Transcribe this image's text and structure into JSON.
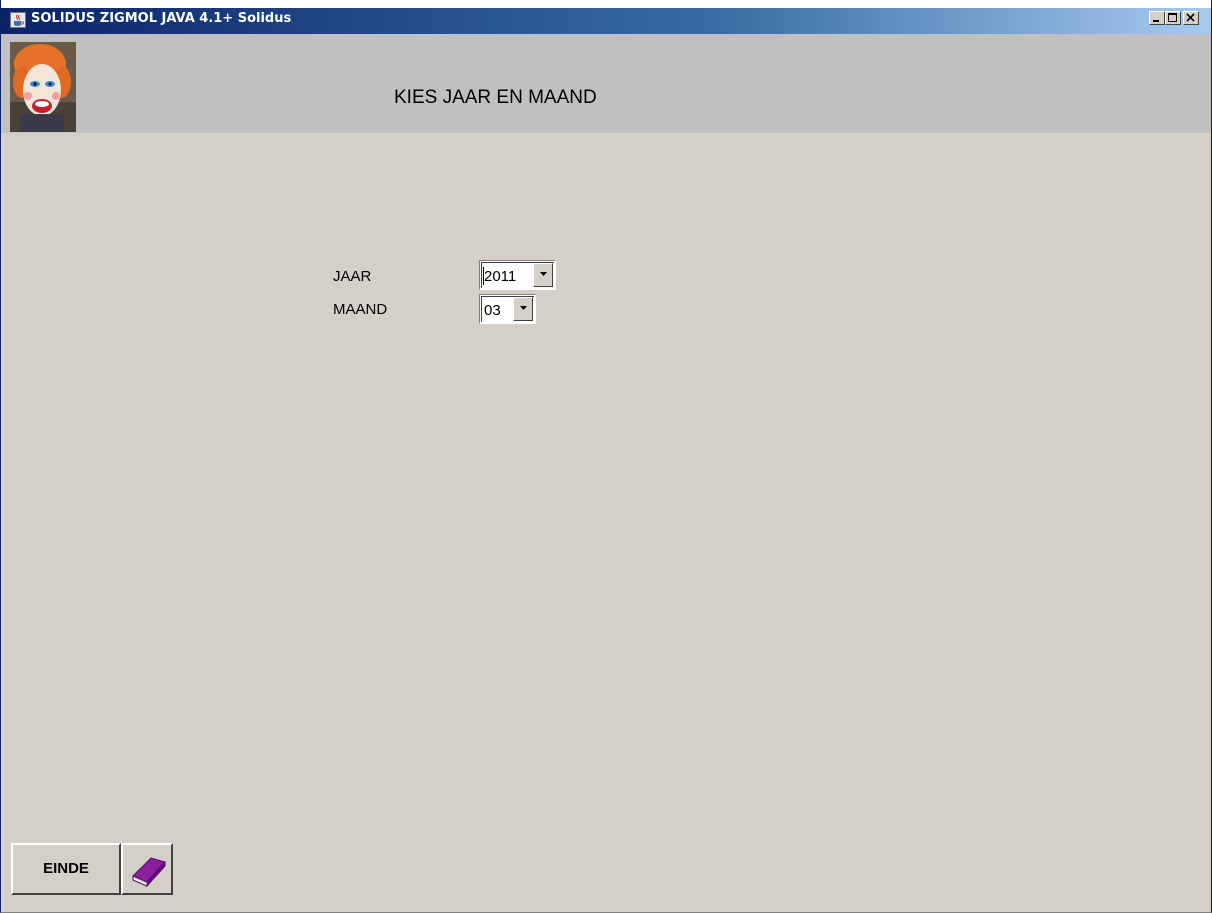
{
  "window": {
    "title": "SOLIDUS ZIGMOL JAVA 4.1+ Solidus",
    "icon": "java-cup-icon",
    "controls": [
      "minimize-icon",
      "maximize-icon",
      "close-icon"
    ]
  },
  "header": {
    "title": "KIES JAAR EN MAAND",
    "logo": "clown-face-logo"
  },
  "form": {
    "jaar": {
      "label": "JAAR",
      "selected": "2011"
    },
    "maand": {
      "label": "MAAND",
      "selected": "03"
    }
  },
  "footer": {
    "einde_label": "EINDE",
    "help_icon": "book-icon"
  },
  "colors": {
    "titlebar_start": "#0a246a",
    "titlebar_end": "#a6caf0",
    "window_bg": "#d4d0c8",
    "header_bg": "#c0c0c0",
    "book_purple": "#8b1fa0"
  }
}
